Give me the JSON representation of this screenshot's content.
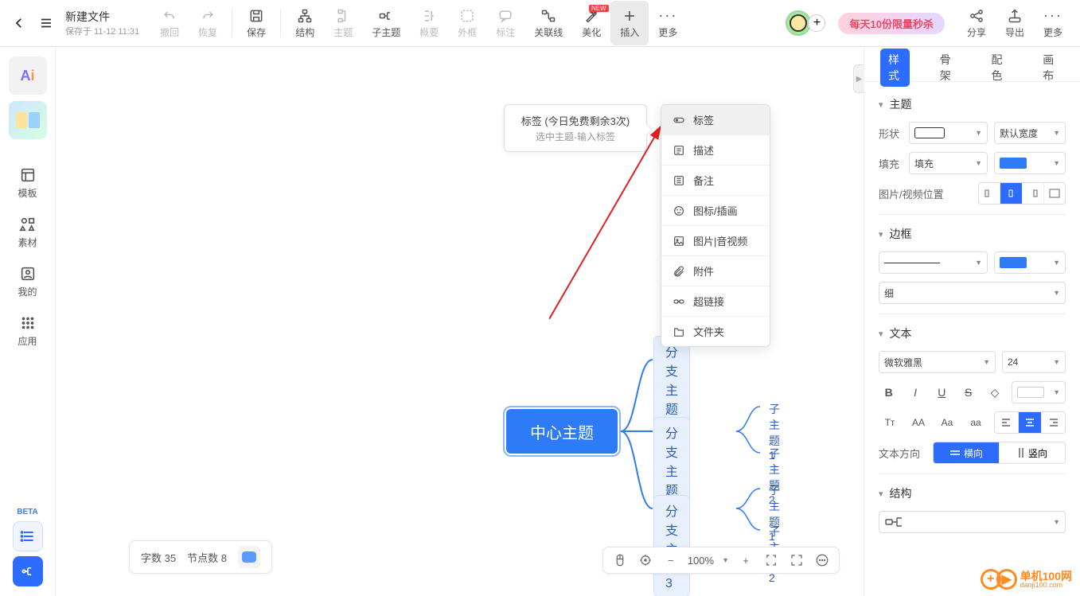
{
  "file": {
    "title": "新建文件",
    "saved": "保存于 11-12 11:31"
  },
  "toolbar": {
    "undo": "撤回",
    "redo": "恢复",
    "save": "保存",
    "struct": "结构",
    "theme": "主题",
    "subtopic": "子主题",
    "summary": "概要",
    "frame": "外框",
    "callout": "标注",
    "relation": "关联线",
    "beautify": "美化",
    "insert": "插入",
    "more": "更多",
    "new_badge": "NEW",
    "share": "分享",
    "export": "导出",
    "more2": "更多"
  },
  "promo": "每天10份限量秒杀",
  "tooltip": {
    "t1": "标签 (今日免费剩余3次)",
    "t2": "选中主题-输入标签"
  },
  "dropdown": {
    "tag": "标签",
    "desc": "描述",
    "note": "备注",
    "icon": "图标/插画",
    "media": "图片|音视频",
    "attach": "附件",
    "link": "超链接",
    "folder": "文件夹"
  },
  "rail": {
    "template": "模板",
    "asset": "素材",
    "mine": "我的",
    "apps": "应用",
    "beta": "BETA"
  },
  "mindmap": {
    "center": "中心主题",
    "b1": "分支主题 1",
    "b2": "分支主题 2",
    "b3": "分支主题 3",
    "s1": "子主题 1",
    "s2": "子主题 2",
    "s3": "子主题 1",
    "s4": "子主题 2"
  },
  "status": {
    "words": "字数 35",
    "nodes": "节点数 8"
  },
  "zoom": {
    "value": "100%"
  },
  "panel": {
    "tabs": {
      "style": "样式",
      "skeleton": "骨架",
      "color": "配色",
      "canvas": "画布"
    },
    "topic": "主题",
    "shape_label": "形状",
    "width_default": "默认宽度",
    "fill_label": "填充",
    "fill_value": "填充",
    "img_pos": "图片/视频位置",
    "border": "边框",
    "border_thin": "细",
    "text": "文本",
    "font": "微软雅黑",
    "size": "24",
    "dir_label": "文本方向",
    "dir_h": "横向",
    "dir_v": "竖向",
    "struct": "结构",
    "colors": {
      "accent": "#2d7bf6"
    }
  },
  "watermark": {
    "brand": "单机100网",
    "url": "danji100.com"
  }
}
